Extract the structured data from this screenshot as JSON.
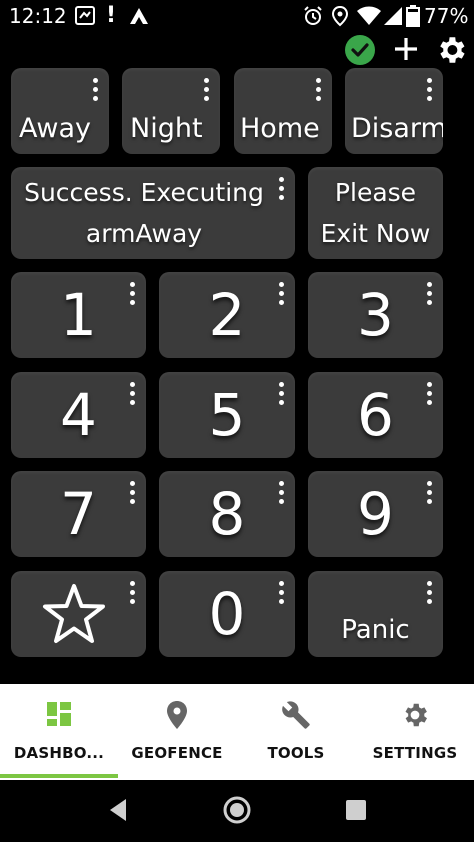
{
  "status_bar": {
    "time": "12:12",
    "battery_pct": "77%"
  },
  "modes": [
    {
      "label": "Away"
    },
    {
      "label": "Night"
    },
    {
      "label": "Home"
    },
    {
      "label": "Disarm"
    }
  ],
  "status_tile": {
    "line1": "Success. Executing",
    "line2": "armAway"
  },
  "exit_tile": {
    "line1": "Please",
    "line2": "Exit Now"
  },
  "keypad": {
    "k1": "1",
    "k2": "2",
    "k3": "3",
    "k4": "4",
    "k5": "5",
    "k6": "6",
    "k7": "7",
    "k8": "8",
    "k9": "9",
    "k0": "0",
    "panic": "Panic"
  },
  "bottom_nav": {
    "dashboard": "DASHBO...",
    "geofence": "GEOFENCE",
    "tools": "TOOLS",
    "settings": "SETTINGS"
  },
  "colors": {
    "accent": "#7cc642",
    "ok_green": "#3aa64a",
    "tile": "#3b3b3b"
  }
}
